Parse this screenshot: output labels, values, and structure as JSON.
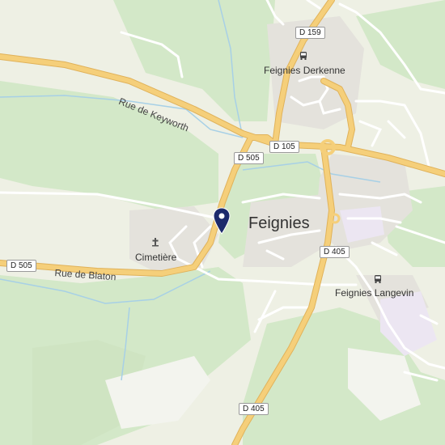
{
  "map": {
    "town_label": "Feignies",
    "places": {
      "derkenne": "Feignies Derkenne",
      "langevin": "Feignies Langevin",
      "cemetery": "Cimetière"
    },
    "streets": {
      "keyworth": "Rue de Keyworth",
      "blaton": "Rue de Blaton"
    },
    "road_shields": {
      "d159": "D 159",
      "d105": "D 105",
      "d505_center": "D 505",
      "d505_west": "D 505",
      "d405_north": "D 405",
      "d405_south": "D 405"
    },
    "icons": [
      "bus-stop-icon",
      "bus-stop-icon",
      "cemetery-icon",
      "location-pin-icon"
    ],
    "colors": {
      "background": "#eef0e4",
      "forest": "#d3e8c8",
      "built_area": "#e4e2dc",
      "road_major": "#f5cf7a",
      "road_outline": "#e0b25a",
      "water": "#a7d0e6",
      "pin": "#1c2a6b"
    }
  }
}
